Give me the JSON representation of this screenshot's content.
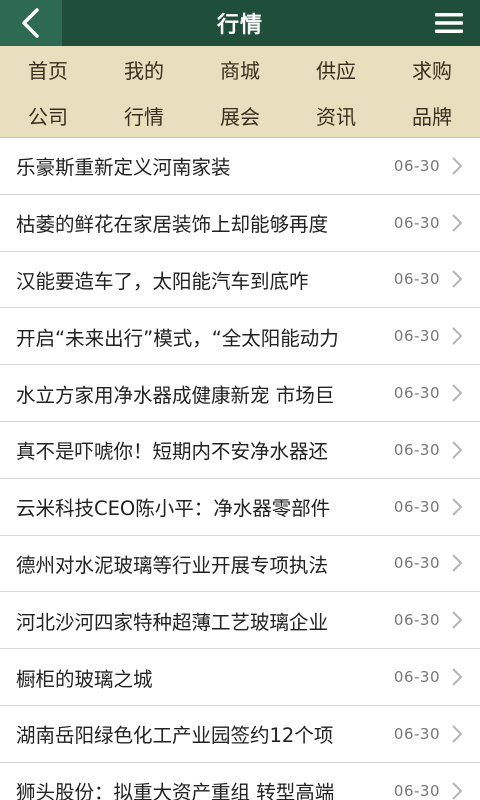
{
  "header": {
    "title": "行情"
  },
  "icons": {
    "back": "back-arrow-icon",
    "menu": "hamburger-menu-icon",
    "chevron": "chevron-right-icon"
  },
  "colors": {
    "header_bg": "#1f4e3b",
    "back_bg": "#2e6a52",
    "nav_bg": "#e8dfbf"
  },
  "nav": {
    "row1": [
      "首页",
      "我的",
      "商城",
      "供应",
      "求购"
    ],
    "row2": [
      "公司",
      "行情",
      "展会",
      "资讯",
      "品牌"
    ]
  },
  "list": {
    "items": [
      {
        "title": "乐豪斯重新定义河南家装",
        "date": "06-30"
      },
      {
        "title": "枯萎的鲜花在家居装饰上却能够再度",
        "date": "06-30"
      },
      {
        "title": "汉能要造车了，太阳能汽车到底咋",
        "date": "06-30"
      },
      {
        "title": "开启“未来出行”模式，“全太阳能动力",
        "date": "06-30"
      },
      {
        "title": "水立方家用净水器成健康新宠 市场巨",
        "date": "06-30"
      },
      {
        "title": "真不是吓唬你！短期内不安净水器还",
        "date": "06-30"
      },
      {
        "title": "云米科技CEO陈小平：净水器零部件",
        "date": "06-30"
      },
      {
        "title": "德州对水泥玻璃等行业开展专项执法",
        "date": "06-30"
      },
      {
        "title": "河北沙河四家特种超薄工艺玻璃企业",
        "date": "06-30"
      },
      {
        "title": "橱柜的玻璃之城",
        "date": "06-30"
      },
      {
        "title": "湖南岳阳绿色化工产业园签约12个项",
        "date": "06-30"
      },
      {
        "title": "狮头股份：拟重大资产重组 转型高端",
        "date": "06-30"
      }
    ]
  }
}
